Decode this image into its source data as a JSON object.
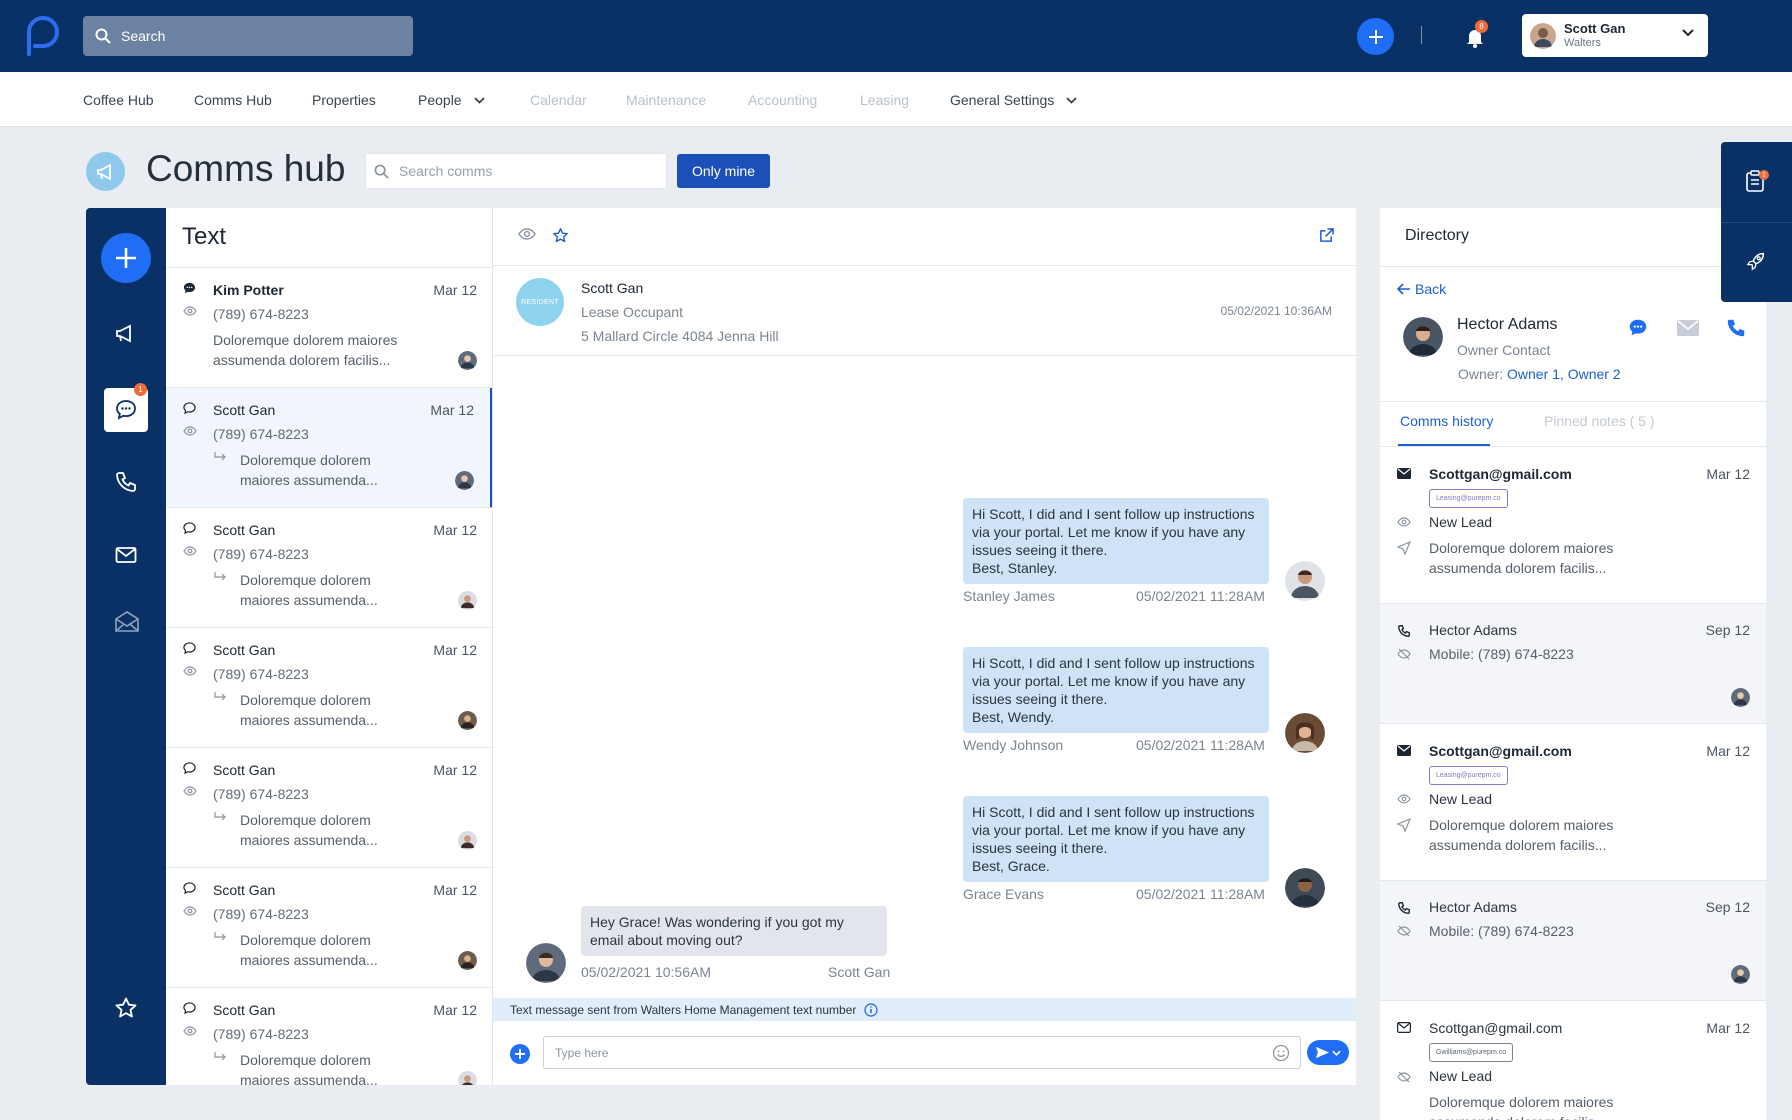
{
  "topbar": {
    "search_placeholder": "Search",
    "notifications_count": "8",
    "user_name": "Scott Gan",
    "user_company": "Walters"
  },
  "nav": {
    "items": [
      "Coffee Hub",
      "Comms Hub",
      "Properties",
      "People",
      "Calendar",
      "Maintenance",
      "Accounting",
      "Leasing",
      "General Settings"
    ]
  },
  "page": {
    "title": "Comms hub",
    "search_placeholder": "Search  comms",
    "only_mine_label": "Only mine"
  },
  "rail": {
    "text_badge": "1"
  },
  "list": {
    "title": "Text",
    "conversations": [
      {
        "name": "Kim Potter",
        "date": "Mar 12",
        "phone": "(789) 674-8223",
        "snippet": "Doloremque dolorem maiores assumenda dolorem facilis..."
      },
      {
        "name": "Scott Gan",
        "date": "Mar 12",
        "phone": "(789) 674-8223",
        "snippet": "Doloremque dolorem maiores assumenda..."
      },
      {
        "name": "Scott Gan",
        "date": "Mar 12",
        "phone": "(789) 674-8223",
        "snippet": "Doloremque dolorem maiores assumenda..."
      },
      {
        "name": "Scott Gan",
        "date": "Mar 12",
        "phone": "(789) 674-8223",
        "snippet": "Doloremque dolorem maiores assumenda..."
      },
      {
        "name": "Scott Gan",
        "date": "Mar 12",
        "phone": "(789) 674-8223",
        "snippet": "Doloremque dolorem maiores assumenda..."
      },
      {
        "name": "Scott Gan",
        "date": "Mar 12",
        "phone": "(789) 674-8223",
        "snippet": "Doloremque dolorem maiores assumenda..."
      },
      {
        "name": "Scott Gan",
        "date": "Mar 12",
        "phone": "(789) 674-8223",
        "snippet": "Doloremque dolorem maiores assumenda..."
      }
    ]
  },
  "chat": {
    "contact": {
      "badge": "RESIDENT",
      "name": "Scott Gan",
      "role": "Lease Occupant",
      "address": "5 Mallard Circle 4084 Jenna Hill",
      "time": "05/02/2021 10:36AM"
    },
    "messages": [
      {
        "text": "Hi Scott, I did and I sent follow up instructions via your portal. Let me know if you have any issues seeing it there.\nBest, Stanley.",
        "sender": "Stanley James",
        "time": "05/02/2021 11:28AM"
      },
      {
        "text": "Hi Scott, I did and I sent follow up instructions via your portal. Let me know if you have any issues seeing it there.\nBest, Wendy.",
        "sender": "Wendy Johnson",
        "time": "05/02/2021 11:28AM"
      },
      {
        "text": "Hi Scott, I did and I sent follow up instructions via your portal. Let me know if you have any issues seeing it there.\nBest, Grace.",
        "sender": "Grace Evans",
        "time": "05/02/2021 11:28AM"
      },
      {
        "text": "Hey Grace! Was wondering if you got my email about moving out?",
        "sender": "Scott Gan",
        "time": "05/02/2021 10:56AM"
      }
    ],
    "sms_note": "Text message sent from Walters Home Management text number",
    "composer_placeholder": "Type here"
  },
  "directory": {
    "title": "Directory",
    "back_label": "Back",
    "contact": {
      "name": "Hector Adams",
      "role": "Owner Contact",
      "owner_label": "Owner:",
      "owner_links": "Owner 1, Owner 2"
    },
    "tabs": [
      "Comms history",
      "Pinned notes ( 5 )"
    ],
    "history": [
      {
        "title": "Scottgan@gmail.com",
        "date": "Mar 12",
        "tag": "Leasing@purepm.co",
        "status": "New Lead",
        "snippet": "Doloremque dolorem maiores assumenda dolorem facilis..."
      },
      {
        "title": "Hector Adams",
        "date": "Sep 12",
        "detail": "Mobile: (789) 674-8223"
      },
      {
        "title": "Scottgan@gmail.com",
        "date": "Mar 12",
        "tag": "Leasing@purepm.co",
        "status": "New Lead",
        "snippet": "Doloremque dolorem maiores assumenda dolorem facilis..."
      },
      {
        "title": "Hector Adams",
        "date": "Sep 12",
        "detail": "Mobile: (789) 674-8223"
      },
      {
        "title": "Scottgan@gmail.com",
        "date": "Mar 12",
        "tag": "Gwilliams@purepm.co",
        "status": "New Lead",
        "snippet": "Doloremque dolorem maiores assumenda dolorem facilis..."
      }
    ]
  },
  "float": {
    "badge": "1"
  },
  "colors": {
    "navy": "#0a3166",
    "accent_blue": "#1f6ef5",
    "badge_orange": "#f26b3a",
    "bubble_blue": "#cfe3f6"
  }
}
